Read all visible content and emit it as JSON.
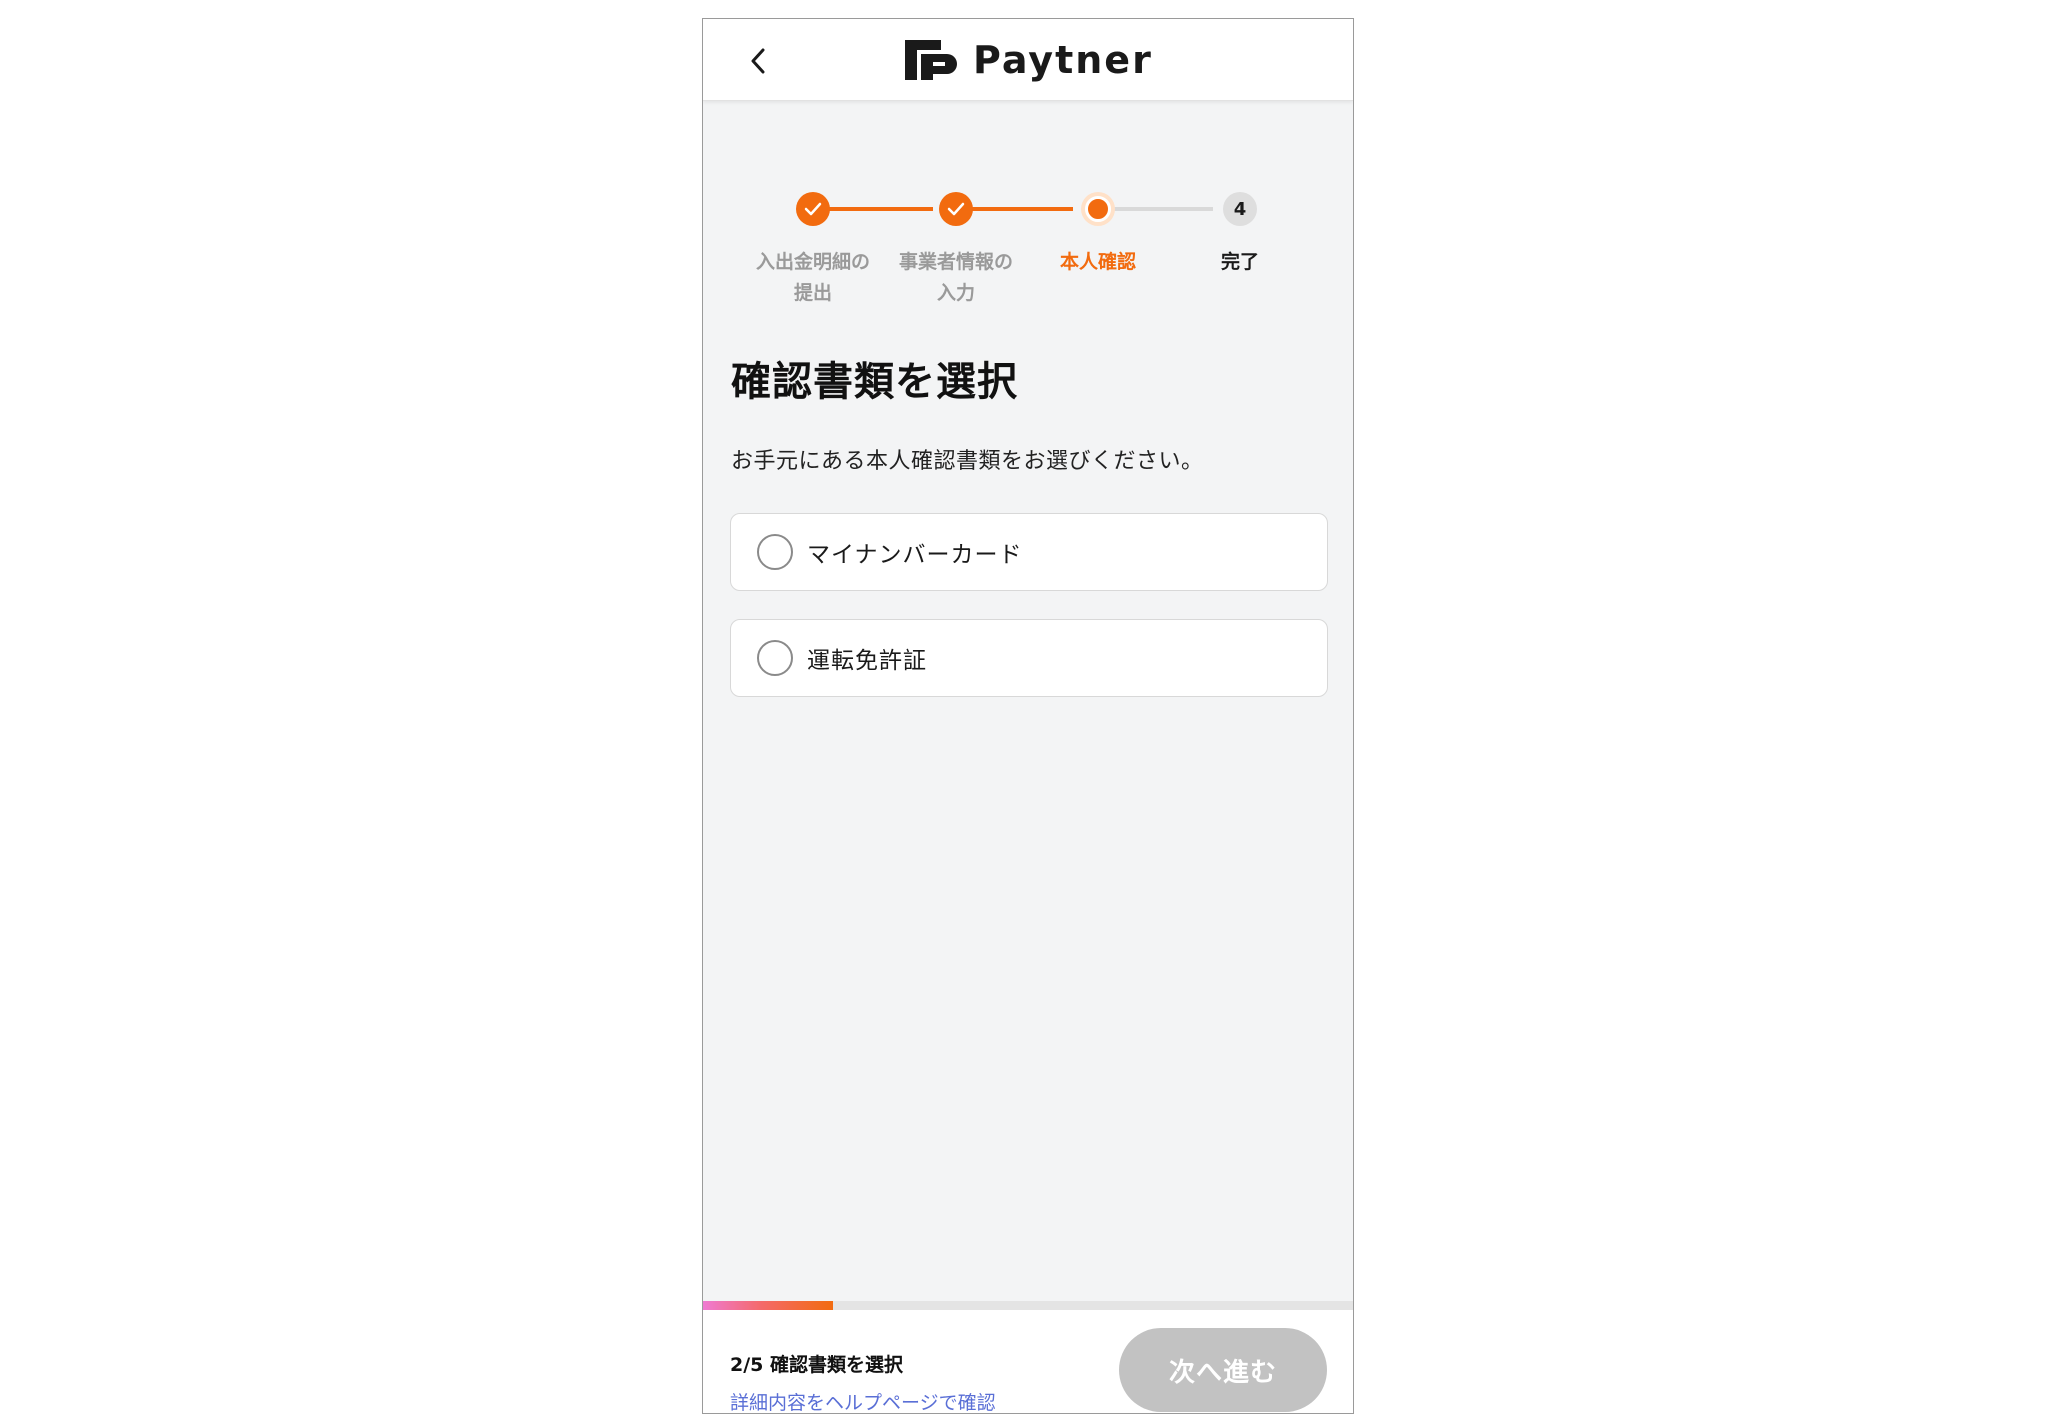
{
  "header": {
    "back_icon": "chevron-left-icon",
    "logo_text": "Paytner"
  },
  "stepper": {
    "steps": [
      {
        "label": "入出金明細の\n提出",
        "state": "done"
      },
      {
        "label": "事業者情報の\n入力",
        "state": "done"
      },
      {
        "label": "本人確認",
        "state": "current"
      },
      {
        "label": "完了",
        "state": "todo",
        "number": "4"
      }
    ]
  },
  "main": {
    "title": "確認書類を選択",
    "description": "お手元にある本人確認書類をお選びください。",
    "options": [
      {
        "label": "マイナンバーカード",
        "selected": false
      },
      {
        "label": "運転免許証",
        "selected": false
      }
    ]
  },
  "footer": {
    "progress": 0.2,
    "step_text": "2/5 確認書類を選択",
    "help_link": "詳細内容をヘルプページで確認",
    "next_label": "次へ進む",
    "next_enabled": false
  },
  "colors": {
    "accent": "#f26b0f",
    "link": "#5a6fd6",
    "disabled_button": "#c2c2c2"
  }
}
